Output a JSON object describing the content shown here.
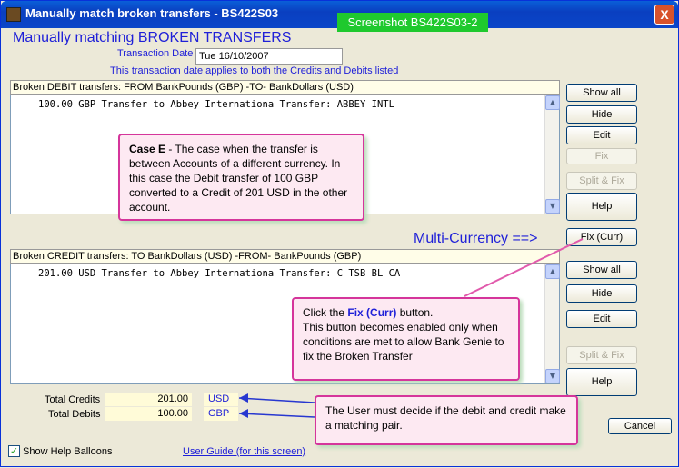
{
  "window": {
    "title": "Manually match broken transfers - BS422S03",
    "badge": "Screenshot BS422S03-2",
    "close_label": "X"
  },
  "heading": "Manually matching BROKEN TRANSFERS",
  "transaction_date": {
    "label": "Transaction Date",
    "value": "Tue 16/10/2007",
    "note": "This transaction date applies to both the Credits and Debits listed"
  },
  "debit": {
    "header": "Broken DEBIT transfers: FROM BankPounds (GBP) -TO- BankDollars (USD)",
    "items": [
      "100.00 GBP Transfer to Abbey Internationa Transfer: ABBEY INTL"
    ]
  },
  "credit": {
    "header": "Broken CREDIT transfers: TO BankDollars (USD) -FROM- BankPounds (GBP)",
    "items": [
      "201.00 USD Transfer to Abbey Internationa Transfer: C TSB BL CA"
    ]
  },
  "buttons": {
    "show_all": "Show all",
    "hide": "Hide",
    "edit": "Edit",
    "fix": "Fix",
    "split_fix": "Split & Fix",
    "help": "Help",
    "fix_curr": "Fix (Curr)",
    "show_all_2": "Show all",
    "hide_2": "Hide",
    "edit_2": "Edit",
    "split_fix_2": "Split & Fix",
    "help_2": "Help",
    "cancel": "Cancel"
  },
  "multi_currency_label": "Multi-Currency ==>",
  "totals": {
    "credits_label": "Total Credits",
    "credits_value": "201.00",
    "credits_currency": "USD",
    "debits_label": "Total Debits",
    "debits_value": "100.00",
    "debits_currency": "GBP"
  },
  "footer": {
    "show_help_label": "Show Help Balloons",
    "checkbox_mark": "✓",
    "user_guide_link": "User Guide (for this screen)"
  },
  "balloons": {
    "case_e_title": "Case E",
    "case_e_text": " - The case when the transfer is between Accounts of a different currency. In this case the Debit transfer of 100 GBP converted to a Credit of 201 USD in the other account.",
    "fix_curr_prefix": "Click the ",
    "fix_curr_button": "Fix (Curr)",
    "fix_curr_suffix": " button.",
    "fix_curr_text": "This button becomes enabled only when conditions are met to allow Bank Genie to fix the Broken Transfer",
    "user_decide_text": "The User must decide if the debit and credit make a matching pair."
  },
  "colors": {
    "accent_blue": "#1f20d8",
    "balloon_border": "#d5359b",
    "badge_green": "#1fc92e"
  }
}
